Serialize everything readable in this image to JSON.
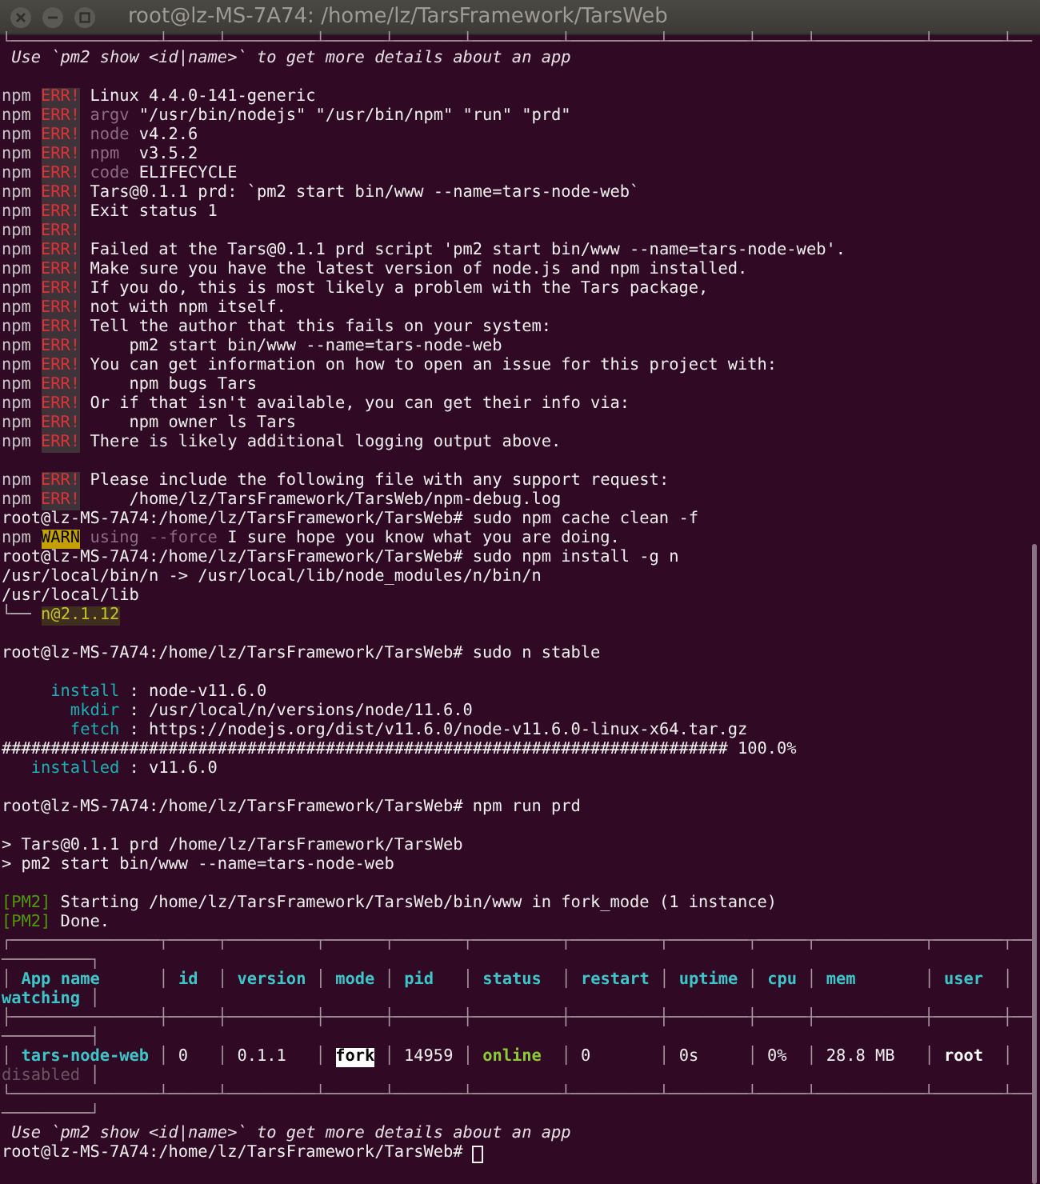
{
  "window": {
    "title": "root@lz-MS-7A74: /home/lz/TarsFramework/TarsWeb"
  },
  "terminal": {
    "lines": [
      {
        "kind": "cut",
        "segments": [
          {
            "text": "└───────────────┴─────┴─────────┴──────┴───────┴─────────┴─────────┴────────┴─────┴───────────┴───────┴──",
            "kind": "border"
          }
        ]
      },
      {
        "kind": "text",
        "segments": [
          {
            "text": " Use `pm2 show <id|name>` to get more details about an app",
            "kind": "hint"
          }
        ]
      },
      {
        "kind": "blank"
      },
      {
        "kind": "text",
        "segments": [
          {
            "text": "npm",
            "kind": "npm"
          },
          {
            "text": "ERR!",
            "kind": "err"
          },
          {
            "text": "Linux 4.4.0-141-generic",
            "kind": "plain"
          }
        ]
      },
      {
        "kind": "text",
        "segments": [
          {
            "text": "npm",
            "kind": "npm"
          },
          {
            "text": "ERR!",
            "kind": "err"
          },
          {
            "text": "argv",
            "kind": "dim"
          },
          {
            "text": " \"/usr/bin/nodejs\" \"/usr/bin/npm\" \"run\" \"prd\"",
            "kind": "plain"
          }
        ]
      },
      {
        "kind": "text",
        "segments": [
          {
            "text": "npm",
            "kind": "npm"
          },
          {
            "text": "ERR!",
            "kind": "err"
          },
          {
            "text": "node",
            "kind": "dim"
          },
          {
            "text": " v4.2.6",
            "kind": "plain"
          }
        ]
      },
      {
        "kind": "text",
        "segments": [
          {
            "text": "npm",
            "kind": "npm"
          },
          {
            "text": "ERR!",
            "kind": "err"
          },
          {
            "text": "npm",
            "kind": "dim"
          },
          {
            "text": "  v3.5.2",
            "kind": "plain"
          }
        ]
      },
      {
        "kind": "text",
        "segments": [
          {
            "text": "npm",
            "kind": "npm"
          },
          {
            "text": "ERR!",
            "kind": "err"
          },
          {
            "text": "code",
            "kind": "dim"
          },
          {
            "text": " ELIFECYCLE",
            "kind": "plain"
          }
        ]
      },
      {
        "kind": "text",
        "segments": [
          {
            "text": "npm",
            "kind": "npm"
          },
          {
            "text": "ERR!",
            "kind": "err"
          },
          {
            "text": "Tars@0.1.1 prd: `pm2 start bin/www --name=tars-node-web`",
            "kind": "plain"
          }
        ]
      },
      {
        "kind": "text",
        "segments": [
          {
            "text": "npm",
            "kind": "npm"
          },
          {
            "text": "ERR!",
            "kind": "err"
          },
          {
            "text": "Exit status 1",
            "kind": "plain"
          }
        ]
      },
      {
        "kind": "text",
        "segments": [
          {
            "text": "npm",
            "kind": "npm"
          },
          {
            "text": "ERR!",
            "kind": "err"
          }
        ]
      },
      {
        "kind": "text",
        "segments": [
          {
            "text": "npm",
            "kind": "npm"
          },
          {
            "text": "ERR!",
            "kind": "err"
          },
          {
            "text": "Failed at the Tars@0.1.1 prd script 'pm2 start bin/www --name=tars-node-web'.",
            "kind": "plain"
          }
        ]
      },
      {
        "kind": "text",
        "segments": [
          {
            "text": "npm",
            "kind": "npm"
          },
          {
            "text": "ERR!",
            "kind": "err"
          },
          {
            "text": "Make sure you have the latest version of node.js and npm installed.",
            "kind": "plain"
          }
        ]
      },
      {
        "kind": "text",
        "segments": [
          {
            "text": "npm",
            "kind": "npm"
          },
          {
            "text": "ERR!",
            "kind": "err"
          },
          {
            "text": "If you do, this is most likely a problem with the Tars package,",
            "kind": "plain"
          }
        ]
      },
      {
        "kind": "text",
        "segments": [
          {
            "text": "npm",
            "kind": "npm"
          },
          {
            "text": "ERR!",
            "kind": "err"
          },
          {
            "text": "not with npm itself.",
            "kind": "plain"
          }
        ]
      },
      {
        "kind": "text",
        "segments": [
          {
            "text": "npm",
            "kind": "npm"
          },
          {
            "text": "ERR!",
            "kind": "err"
          },
          {
            "text": "Tell the author that this fails on your system:",
            "kind": "plain"
          }
        ]
      },
      {
        "kind": "text",
        "segments": [
          {
            "text": "npm",
            "kind": "npm"
          },
          {
            "text": "ERR!",
            "kind": "err"
          },
          {
            "text": "    pm2 start bin/www --name=tars-node-web",
            "kind": "plain"
          }
        ]
      },
      {
        "kind": "text",
        "segments": [
          {
            "text": "npm",
            "kind": "npm"
          },
          {
            "text": "ERR!",
            "kind": "err"
          },
          {
            "text": "You can get information on how to open an issue for this project with:",
            "kind": "plain"
          }
        ]
      },
      {
        "kind": "text",
        "segments": [
          {
            "text": "npm",
            "kind": "npm"
          },
          {
            "text": "ERR!",
            "kind": "err"
          },
          {
            "text": "    npm bugs Tars",
            "kind": "plain"
          }
        ]
      },
      {
        "kind": "text",
        "segments": [
          {
            "text": "npm",
            "kind": "npm"
          },
          {
            "text": "ERR!",
            "kind": "err"
          },
          {
            "text": "Or if that isn't available, you can get their info via:",
            "kind": "plain"
          }
        ]
      },
      {
        "kind": "text",
        "segments": [
          {
            "text": "npm",
            "kind": "npm"
          },
          {
            "text": "ERR!",
            "kind": "err"
          },
          {
            "text": "    npm owner ls Tars",
            "kind": "plain"
          }
        ]
      },
      {
        "kind": "text",
        "segments": [
          {
            "text": "npm",
            "kind": "npm"
          },
          {
            "text": "ERR!",
            "kind": "err"
          },
          {
            "text": "There is likely additional logging output above.",
            "kind": "plain"
          }
        ]
      },
      {
        "kind": "blank"
      },
      {
        "kind": "text",
        "segments": [
          {
            "text": "npm",
            "kind": "npm"
          },
          {
            "text": "ERR!",
            "kind": "err"
          },
          {
            "text": "Please include the following file with any support request:",
            "kind": "plain"
          }
        ]
      },
      {
        "kind": "text",
        "segments": [
          {
            "text": "npm",
            "kind": "npm"
          },
          {
            "text": "ERR!",
            "kind": "err"
          },
          {
            "text": "    /home/lz/TarsFramework/TarsWeb/npm-debug.log",
            "kind": "plain"
          }
        ]
      },
      {
        "kind": "text",
        "segments": [
          {
            "text": "root@lz-MS-7A74:/home/lz/TarsFramework/TarsWeb# sudo npm cache clean -f",
            "kind": "plain"
          }
        ]
      },
      {
        "kind": "text",
        "segments": [
          {
            "text": "npm",
            "kind": "npm"
          },
          {
            "text": "WARN",
            "kind": "warn"
          },
          {
            "text": "using --force",
            "kind": "dim"
          },
          {
            "text": " I sure hope you know what you are doing.",
            "kind": "plain"
          }
        ]
      },
      {
        "kind": "text",
        "segments": [
          {
            "text": "root@lz-MS-7A74:/home/lz/TarsFramework/TarsWeb# sudo npm install -g n",
            "kind": "plain"
          }
        ]
      },
      {
        "kind": "text",
        "segments": [
          {
            "text": "/usr/local/bin/n -> /usr/local/lib/node_modules/n/bin/n",
            "kind": "plain"
          }
        ]
      },
      {
        "kind": "text",
        "segments": [
          {
            "text": "/usr/local/lib",
            "kind": "plain"
          }
        ]
      },
      {
        "kind": "text",
        "segments": [
          {
            "text": "└── ",
            "kind": "tree"
          },
          {
            "text": "n@2.1.12",
            "kind": "pkg"
          }
        ]
      },
      {
        "kind": "blank"
      },
      {
        "kind": "text",
        "segments": [
          {
            "text": "root@lz-MS-7A74:/home/lz/TarsFramework/TarsWeb# sudo n stable",
            "kind": "plain"
          }
        ]
      },
      {
        "kind": "blank"
      },
      {
        "kind": "text",
        "segments": [
          {
            "text": "     install",
            "kind": "step"
          },
          {
            "text": " : node-v11.6.0",
            "kind": "plain"
          }
        ]
      },
      {
        "kind": "text",
        "segments": [
          {
            "text": "       mkdir",
            "kind": "step"
          },
          {
            "text": " : /usr/local/n/versions/node/11.6.0",
            "kind": "plain"
          }
        ]
      },
      {
        "kind": "text",
        "segments": [
          {
            "text": "       fetch",
            "kind": "step"
          },
          {
            "text": " : https://nodejs.org/dist/v11.6.0/node-v11.6.0-linux-x64.tar.gz",
            "kind": "plain"
          }
        ]
      },
      {
        "kind": "text",
        "segments": [
          {
            "text": "########################################################################## 100.0%",
            "kind": "plain"
          }
        ]
      },
      {
        "kind": "text",
        "segments": [
          {
            "text": "   installed",
            "kind": "step"
          },
          {
            "text": " : v11.6.0",
            "kind": "plain"
          }
        ]
      },
      {
        "kind": "blank"
      },
      {
        "kind": "text",
        "segments": [
          {
            "text": "root@lz-MS-7A74:/home/lz/TarsFramework/TarsWeb# npm run prd",
            "kind": "plain"
          }
        ]
      },
      {
        "kind": "blank"
      },
      {
        "kind": "text",
        "segments": [
          {
            "text": "> Tars@0.1.1 prd /home/lz/TarsFramework/TarsWeb",
            "kind": "plain"
          }
        ]
      },
      {
        "kind": "text",
        "segments": [
          {
            "text": "> pm2 start bin/www --name=tars-node-web",
            "kind": "plain"
          }
        ]
      },
      {
        "kind": "blank"
      },
      {
        "kind": "text",
        "segments": [
          {
            "text": "[PM2]",
            "kind": "pm2"
          },
          {
            "text": " Starting /home/lz/TarsFramework/TarsWeb/bin/www in fork_mode (1 instance)",
            "kind": "plain"
          }
        ]
      },
      {
        "kind": "text",
        "segments": [
          {
            "text": "[PM2]",
            "kind": "pm2"
          },
          {
            "text": " Done.",
            "kind": "plain"
          }
        ]
      },
      {
        "kind": "text",
        "segments": [
          {
            "text": "┌───────────────┬─────┬─────────┬──────┬───────┬─────────┬─────────┬────────┬─────┬───────────┬───────┬──",
            "kind": "border"
          }
        ]
      },
      {
        "kind": "text",
        "segments": [
          {
            "text": "─────────┐",
            "kind": "border"
          }
        ]
      },
      {
        "kind": "text",
        "segments": [
          {
            "text": "│ ",
            "kind": "border"
          },
          {
            "text": "App name",
            "kind": "head"
          },
          {
            "text": "      │ ",
            "kind": "border"
          },
          {
            "text": "id",
            "kind": "head"
          },
          {
            "text": "  │ ",
            "kind": "border"
          },
          {
            "text": "version",
            "kind": "head"
          },
          {
            "text": " │ ",
            "kind": "border"
          },
          {
            "text": "mode",
            "kind": "head"
          },
          {
            "text": " │ ",
            "kind": "border"
          },
          {
            "text": "pid",
            "kind": "head"
          },
          {
            "text": "   │ ",
            "kind": "border"
          },
          {
            "text": "status",
            "kind": "head"
          },
          {
            "text": "  │ ",
            "kind": "border"
          },
          {
            "text": "restart",
            "kind": "head"
          },
          {
            "text": " │ ",
            "kind": "border"
          },
          {
            "text": "uptime",
            "kind": "head"
          },
          {
            "text": " │ ",
            "kind": "border"
          },
          {
            "text": "cpu",
            "kind": "head"
          },
          {
            "text": " │ ",
            "kind": "border"
          },
          {
            "text": "mem",
            "kind": "head"
          },
          {
            "text": "       │ ",
            "kind": "border"
          },
          {
            "text": "user",
            "kind": "head"
          },
          {
            "text": "  │",
            "kind": "border"
          }
        ]
      },
      {
        "kind": "text",
        "segments": [
          {
            "text": "watching",
            "kind": "head"
          },
          {
            "text": " │",
            "kind": "border"
          }
        ]
      },
      {
        "kind": "text",
        "segments": [
          {
            "text": "├───────────────┼─────┼─────────┼──────┼───────┼─────────┼─────────┼────────┼─────┼───────────┼───────┼──",
            "kind": "border"
          }
        ]
      },
      {
        "kind": "text",
        "segments": [
          {
            "text": "─────────┤",
            "kind": "border"
          }
        ]
      },
      {
        "kind": "text",
        "segments": [
          {
            "text": "│ ",
            "kind": "border"
          },
          {
            "text": "tars-node-web",
            "kind": "app"
          },
          {
            "text": " │ ",
            "kind": "border"
          },
          {
            "text": "0",
            "kind": "cell"
          },
          {
            "text": "   │ ",
            "kind": "border"
          },
          {
            "text": "0.1.1",
            "kind": "cell"
          },
          {
            "text": "   │ ",
            "kind": "border"
          },
          {
            "text": "fork",
            "kind": "inverse"
          },
          {
            "text": " │ ",
            "kind": "border"
          },
          {
            "text": "14959",
            "kind": "cell"
          },
          {
            "text": " │ ",
            "kind": "border"
          },
          {
            "text": "online",
            "kind": "ok"
          },
          {
            "text": "  │ ",
            "kind": "border"
          },
          {
            "text": "0",
            "kind": "cell"
          },
          {
            "text": "       │ ",
            "kind": "border"
          },
          {
            "text": "0s",
            "kind": "cell"
          },
          {
            "text": "     │ ",
            "kind": "border"
          },
          {
            "text": "0%",
            "kind": "cell"
          },
          {
            "text": "  │ ",
            "kind": "border"
          },
          {
            "text": "28.8 MB",
            "kind": "cell"
          },
          {
            "text": "   │ ",
            "kind": "border"
          },
          {
            "text": "root",
            "kind": "bold"
          },
          {
            "text": "  │",
            "kind": "border"
          }
        ]
      },
      {
        "kind": "text",
        "segments": [
          {
            "text": "disabled",
            "kind": "muted"
          },
          {
            "text": " │",
            "kind": "border"
          }
        ]
      },
      {
        "kind": "text",
        "segments": [
          {
            "text": "└───────────────┴─────┴─────────┴──────┴───────┴─────────┴─────────┴────────┴─────┴───────────┴───────┴──",
            "kind": "border"
          }
        ]
      },
      {
        "kind": "text",
        "segments": [
          {
            "text": "─────────┘",
            "kind": "border"
          }
        ]
      },
      {
        "kind": "text",
        "segments": [
          {
            "text": " Use `pm2 show <id|name>` to get more details about an app",
            "kind": "hint"
          }
        ]
      },
      {
        "kind": "prompt",
        "segments": [
          {
            "text": "root@lz-MS-7A74:/home/lz/TarsFramework/TarsWeb# ",
            "kind": "plain"
          }
        ]
      }
    ]
  }
}
